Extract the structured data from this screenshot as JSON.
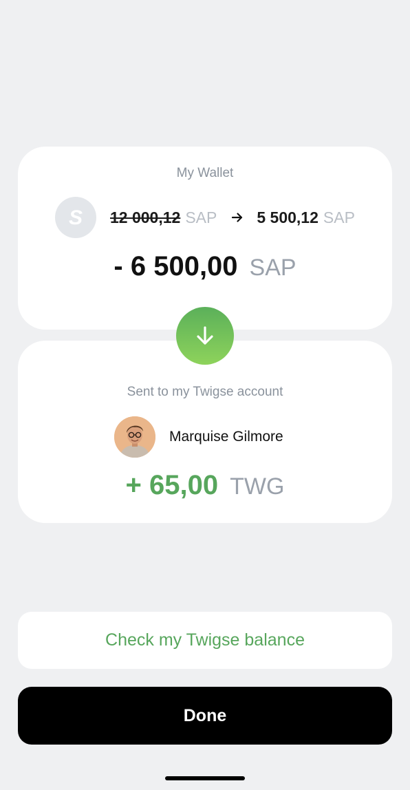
{
  "wallet": {
    "label": "My Wallet",
    "token_icon": "s-token-icon",
    "old_amount": "12 000,12",
    "old_currency": "SAP",
    "new_amount": "5 500,12",
    "new_currency": "SAP",
    "change_amount": "- 6 500,00",
    "change_currency": "SAP"
  },
  "transfer": {
    "icon": "arrow-down-icon",
    "accent_color": "#6cbf58"
  },
  "recipient": {
    "label": "Sent to my Twigse account",
    "name": "Marquise Gilmore",
    "amount": "+ 65,00",
    "currency": "TWG",
    "amount_color": "#57a65c"
  },
  "actions": {
    "check_balance_label": "Check my Twigse balance",
    "done_label": "Done"
  }
}
